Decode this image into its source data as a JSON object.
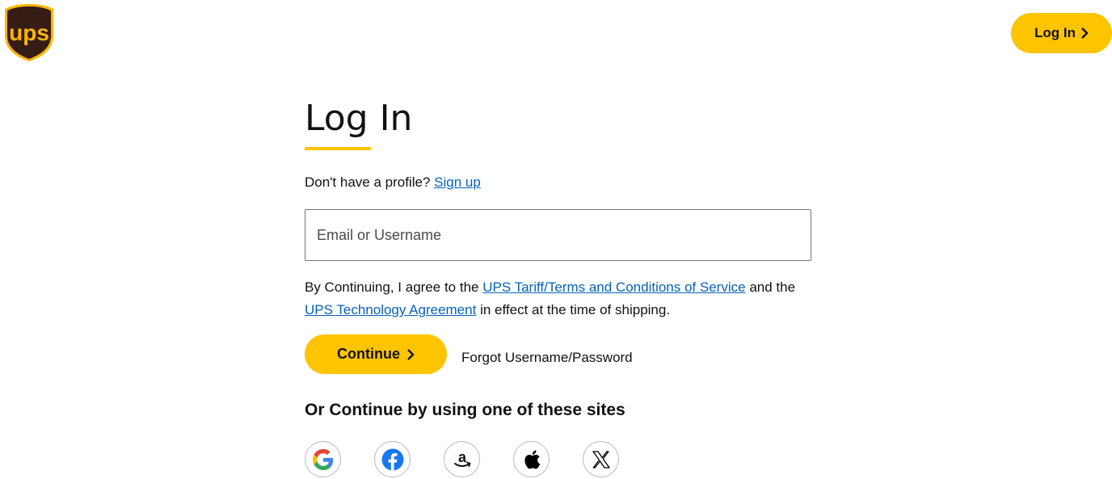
{
  "header": {
    "logo_text": "ups",
    "login_label": "Log In"
  },
  "main": {
    "title": "Log In",
    "signup_prompt": "Don't have a profile?",
    "signup_link": "Sign up",
    "email_placeholder": "Email or Username",
    "terms_prefix": "By Continuing, I agree to the",
    "terms_link_tariff": "UPS Tariff/Terms and Conditions of Service",
    "terms_middle": "and the",
    "terms_link_technology": "UPS Technology Agreement",
    "terms_suffix": "in effect at the time of shipping.",
    "continue_label": "Continue",
    "forgot_label": "Forgot Username/Password",
    "alt_heading": "Or Continue by using one of these sites"
  },
  "social": [
    "google-icon",
    "facebook-icon",
    "amazon-icon",
    "apple-icon",
    "x-icon"
  ],
  "colors": {
    "accent": "#FFC400",
    "link": "#0662BB",
    "ups_brown": "#351C15",
    "ups_gold": "#FFB500"
  }
}
